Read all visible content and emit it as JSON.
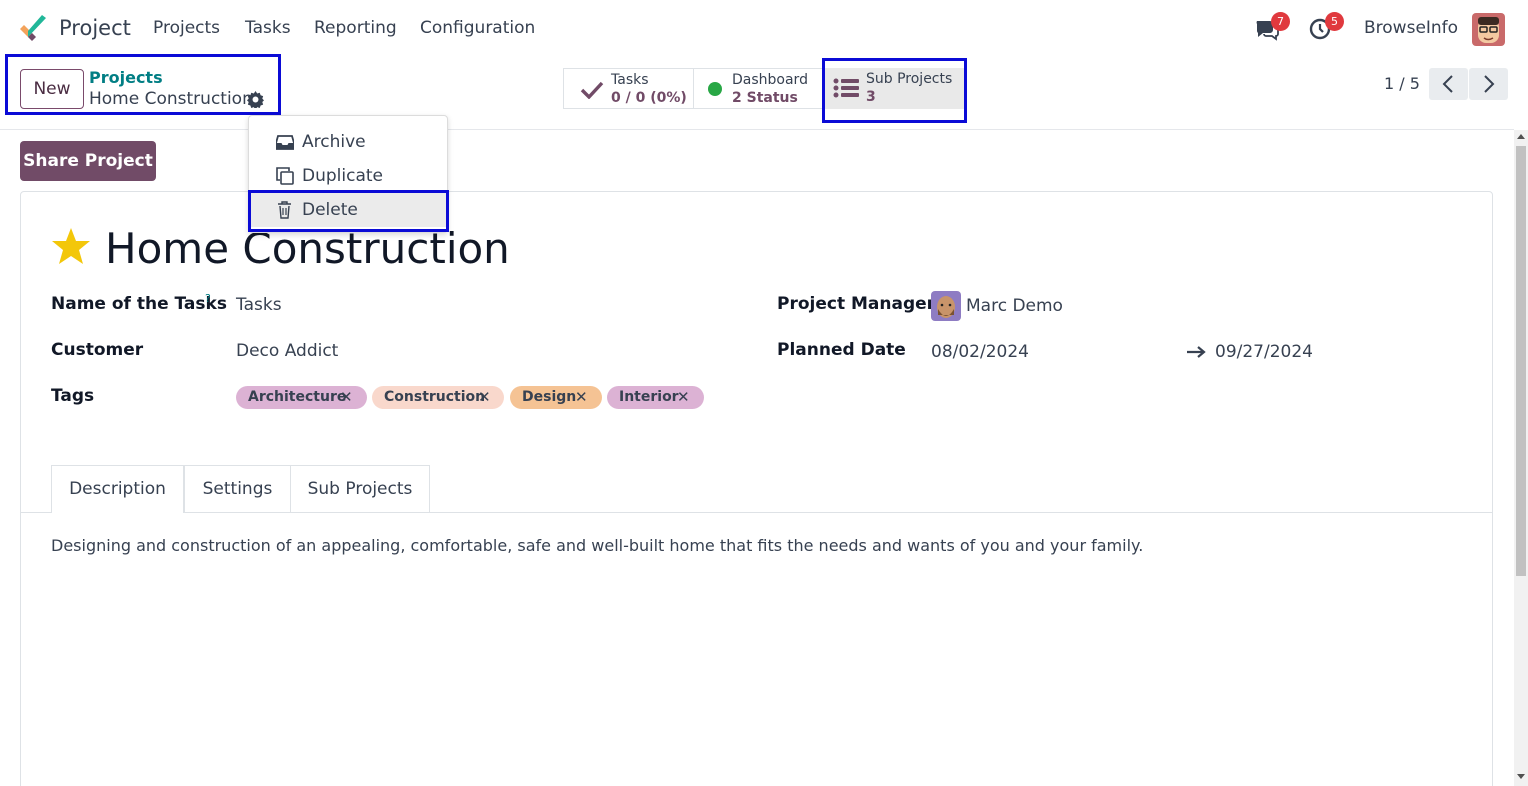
{
  "navbar": {
    "app_name": "Project",
    "menu": [
      "Projects",
      "Tasks",
      "Reporting",
      "Configuration"
    ],
    "messages_count": "7",
    "activities_count": "5",
    "user_name": "BrowseInfo"
  },
  "control_panel": {
    "new_label": "New",
    "breadcrumb_parent": "Projects",
    "breadcrumb_current": "Home Construction",
    "stats": {
      "tasks_label": "Tasks",
      "tasks_value": "0 / 0 (0%)",
      "dashboard_label": "Dashboard",
      "dashboard_value": "2 Status",
      "subprojects_label": "Sub Projects",
      "subprojects_value": "3"
    },
    "pager": "1 / 5"
  },
  "dropdown": {
    "items": [
      "Archive",
      "Duplicate",
      "Delete"
    ]
  },
  "share_label": "Share Project",
  "form": {
    "title": "Home Construction",
    "help_mark": "?",
    "fields": {
      "name_tasks_label": "Name of the Tasks",
      "name_tasks_value": "Tasks",
      "customer_label": "Customer",
      "customer_value": "Deco Addict",
      "tags_label": "Tags",
      "manager_label": "Project Manager",
      "manager_value": "Marc Demo",
      "planned_label": "Planned Date",
      "planned_start": "08/02/2024",
      "planned_end": "09/27/2024"
    },
    "tags": [
      "Architecture",
      "Construction",
      "Design",
      "Interior"
    ],
    "tag_colors": [
      "#dcb2d4",
      "#f9d8cc",
      "#f5c394",
      "#dcb2d4"
    ],
    "tabs": [
      "Description",
      "Settings",
      "Sub Projects"
    ],
    "description": "Designing and construction of an appealing, comfortable, safe and well-built home that fits the needs and wants of you and your family."
  },
  "colors": {
    "brand": "#714b67",
    "link": "#017e84",
    "highlight": "#0b0bd6",
    "badge": "#e0393e"
  }
}
